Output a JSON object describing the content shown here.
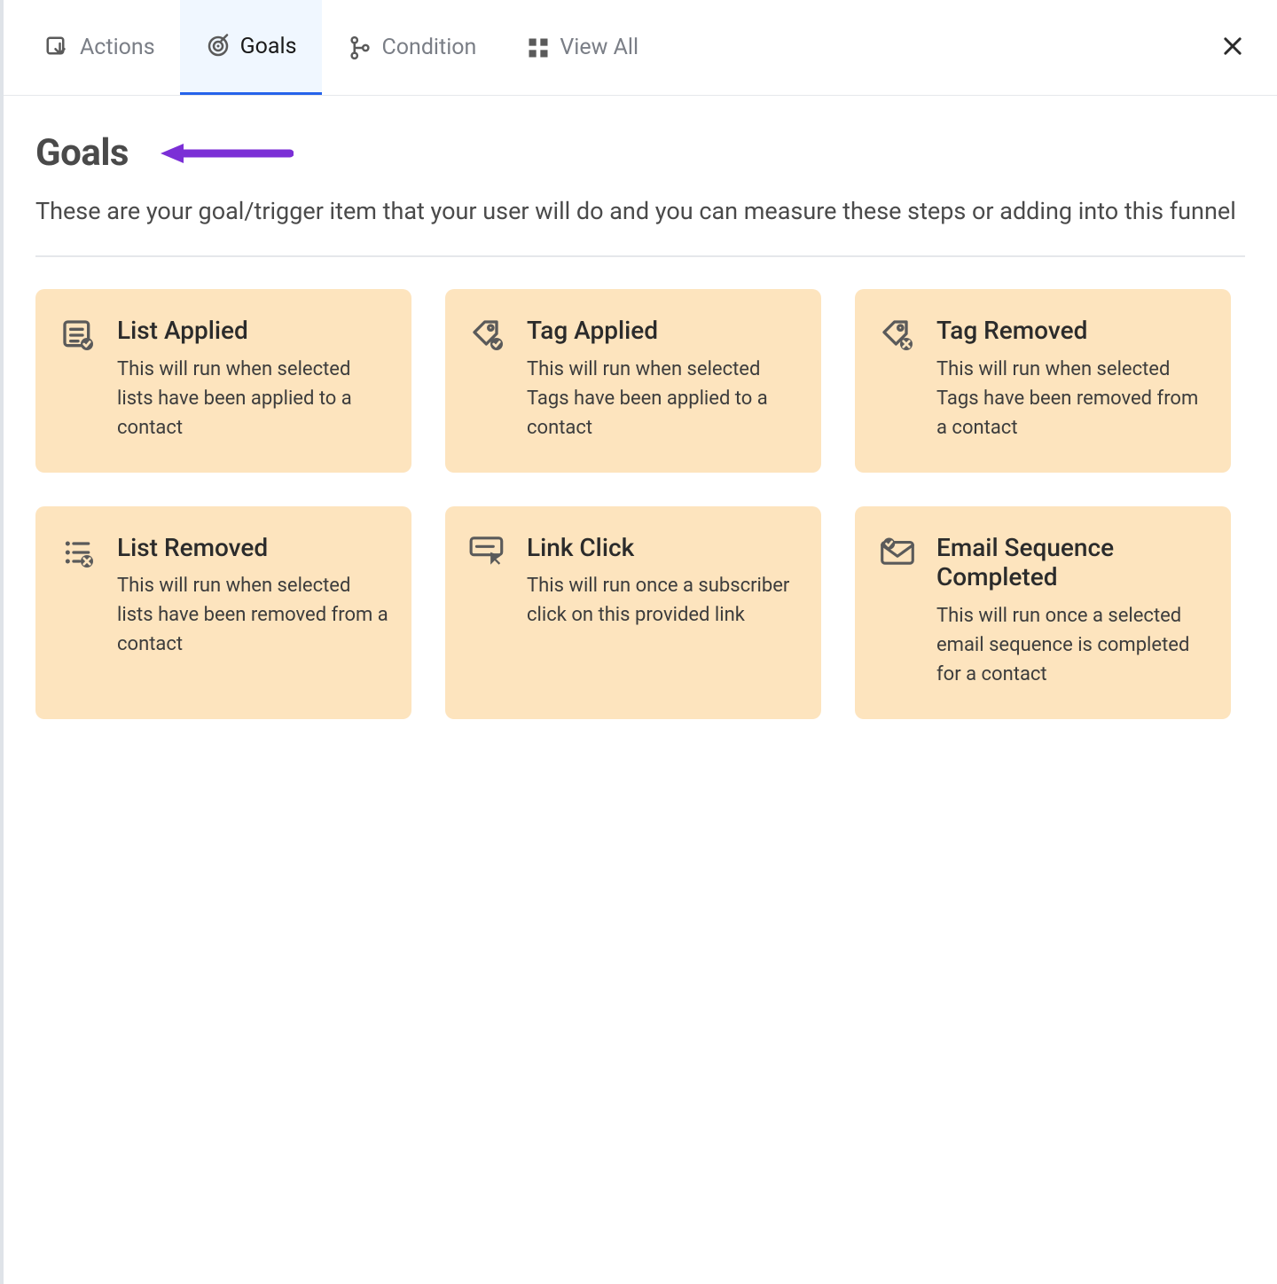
{
  "tabs": {
    "actions": "Actions",
    "goals": "Goals",
    "condition": "Condition",
    "view_all": "View All"
  },
  "heading": "Goals",
  "subheading": "These are your goal/trigger item that your user will do and you can measure these steps or adding into this funnel",
  "cards": [
    {
      "title": "List Applied",
      "desc": "This will run when selected lists have been applied to a contact"
    },
    {
      "title": "Tag Applied",
      "desc": "This will run when selected Tags have been applied to a contact"
    },
    {
      "title": "Tag Removed",
      "desc": "This will run when selected Tags have been removed from a contact"
    },
    {
      "title": "List Removed",
      "desc": "This will run when selected lists have been removed from a contact"
    },
    {
      "title": "Link Click",
      "desc": "This will run once a subscriber click on this provided link"
    },
    {
      "title": "Email Sequence Completed",
      "desc": "This will run once a selected email sequence is completed for a contact"
    }
  ],
  "annotation": {
    "arrow_color": "#7b2fd6"
  }
}
